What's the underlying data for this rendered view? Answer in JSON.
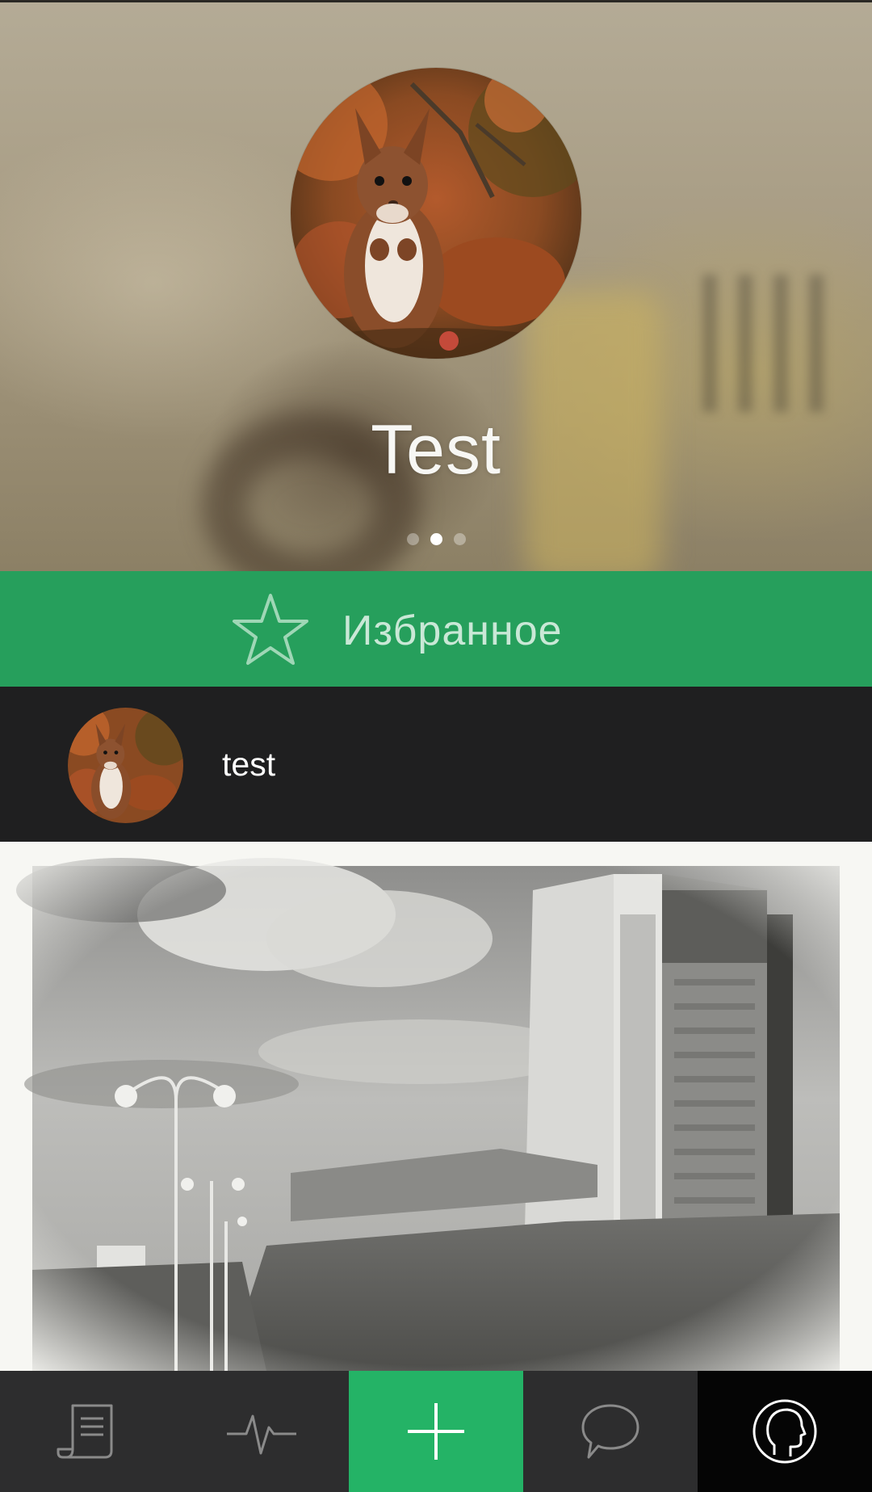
{
  "profile": {
    "name": "Test",
    "avatar_icon": "squirrel-photo",
    "pager": {
      "count": 3,
      "active_index": 1
    }
  },
  "favorites": {
    "label": "Избранное",
    "icon": "star-outline-icon"
  },
  "list": {
    "items": [
      {
        "label": "test",
        "avatar_icon": "squirrel-photo"
      }
    ]
  },
  "post": {
    "image_icon": "grayscale-city-photo"
  },
  "tab_bar": {
    "items": [
      {
        "icon": "feed-scroll-icon"
      },
      {
        "icon": "activity-pulse-icon"
      },
      {
        "icon": "plus-icon"
      },
      {
        "icon": "chat-bubble-icon"
      },
      {
        "icon": "profile-head-icon"
      }
    ]
  },
  "colors": {
    "accent_green": "#269f5c",
    "add_tab_green": "#24b366",
    "dark_row": "#1f1f20",
    "tab_bar_bg": "#2d2d2e",
    "active_tab_bg": "#050505"
  }
}
